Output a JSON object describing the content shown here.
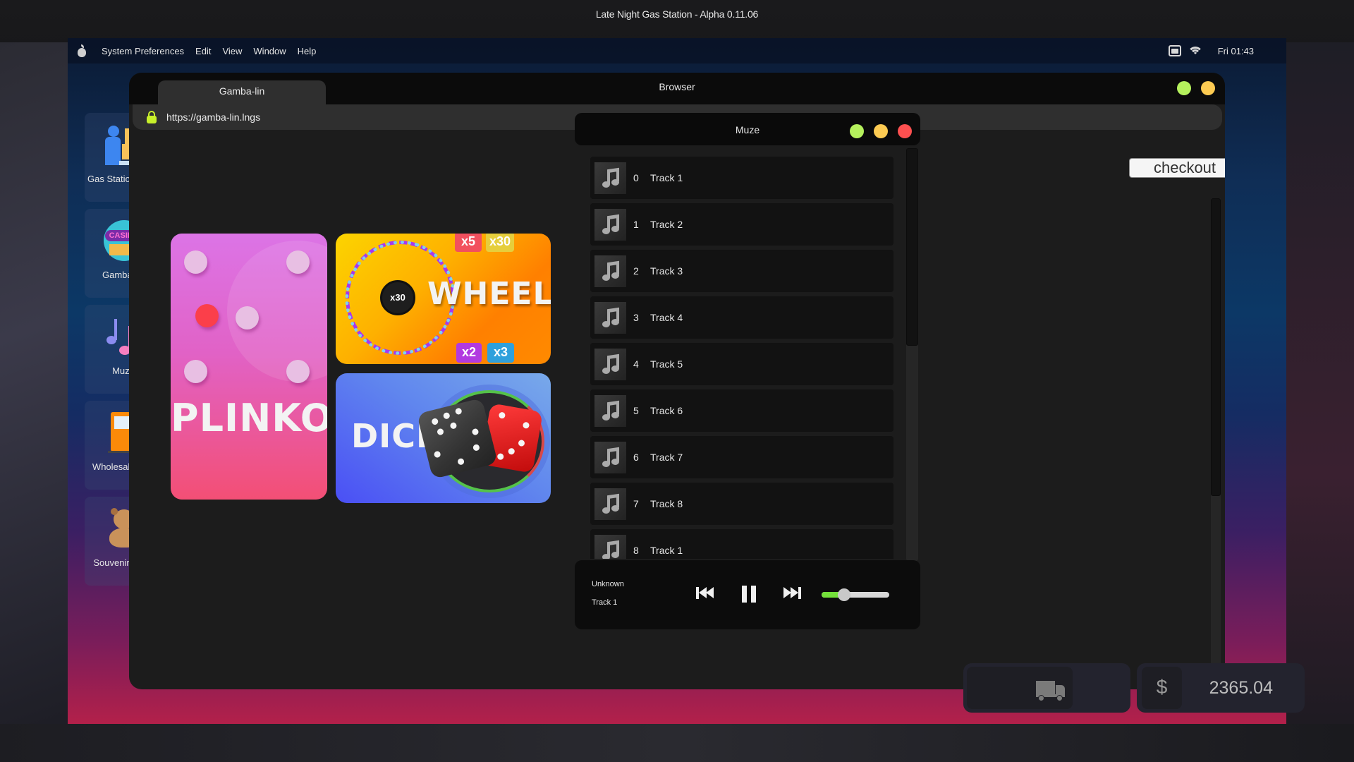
{
  "game": {
    "title": "Late Night Gas Station - Alpha 0.11.06"
  },
  "menubar": {
    "apple_icon": "pear-logo-icon",
    "items": [
      "System Preferences",
      "Edit",
      "View",
      "Window",
      "Help"
    ],
    "status_icons": [
      "network-icon",
      "wifi-icon"
    ],
    "clock": "Fri 01:43"
  },
  "desktop": {
    "icons": [
      {
        "label": "Gas Station Shop",
        "icon": "delivery-worker-icon"
      },
      {
        "label": "Gamba-lin",
        "icon": "casino-icon"
      },
      {
        "label": "Muze",
        "icon": "music-notes-icon"
      },
      {
        "label": "Wholesale Gas",
        "icon": "gas-pump-icon"
      },
      {
        "label": "Souvenir Shop",
        "icon": "teddy-bear-icon"
      }
    ]
  },
  "browser": {
    "window_title": "Browser",
    "tab_label": "Gamba-lin",
    "url": "https://gamba-lin.lngs",
    "colors": {
      "minimize": "#b5f15d",
      "maximize": "#fdcb52",
      "close": "#fd5050",
      "lock": "#c8f02a"
    },
    "games": [
      {
        "name": "PLINKO"
      },
      {
        "name": "WHEEL",
        "hub_label": "x30",
        "multipliers": [
          "x5",
          "x30",
          "x2",
          "x3"
        ]
      },
      {
        "name": "DICE"
      }
    ],
    "checkout_label": "checkout"
  },
  "muze": {
    "window_title": "Muze",
    "tracks": [
      {
        "index": "0",
        "name": "Track 1"
      },
      {
        "index": "1",
        "name": "Track 2"
      },
      {
        "index": "2",
        "name": "Track 3"
      },
      {
        "index": "3",
        "name": "Track 4"
      },
      {
        "index": "4",
        "name": "Track 5"
      },
      {
        "index": "5",
        "name": "Track 6"
      },
      {
        "index": "6",
        "name": "Track 7"
      },
      {
        "index": "7",
        "name": "Track 8"
      },
      {
        "index": "8",
        "name": "Track 1"
      }
    ],
    "now_playing": {
      "artist": "Unknown",
      "track": "Track 1"
    },
    "state": "playing",
    "volume_percent": 33,
    "volume_color": "#74e03a"
  },
  "hud": {
    "truck_icon": "delivery-truck-icon",
    "currency_symbol": "$",
    "money": "2365.04"
  }
}
